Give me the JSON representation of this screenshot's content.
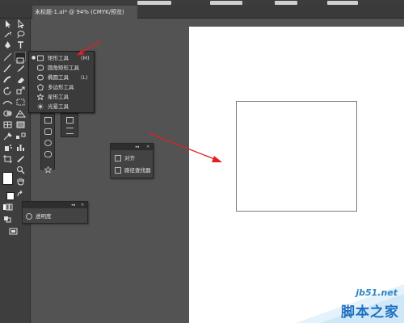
{
  "tab": {
    "title": "未标题-1.ai* @ 94% (CMYK/预览)"
  },
  "flyout": {
    "items": [
      {
        "label": "矩形工具",
        "shortcut": "(M)",
        "icon": "rectangle-icon",
        "selected": true
      },
      {
        "label": "圆角矩形工具",
        "shortcut": "",
        "icon": "rounded-rectangle-icon",
        "selected": false
      },
      {
        "label": "椭圆工具",
        "shortcut": "(L)",
        "icon": "ellipse-icon",
        "selected": false
      },
      {
        "label": "多边形工具",
        "shortcut": "",
        "icon": "polygon-icon",
        "selected": false
      },
      {
        "label": "星形工具",
        "shortcut": "",
        "icon": "star-icon",
        "selected": false
      },
      {
        "label": "光晕工具",
        "shortcut": "",
        "icon": "flare-icon",
        "selected": false
      }
    ]
  },
  "panels": {
    "align": {
      "items": [
        {
          "label": "对齐",
          "icon": "align-icon"
        },
        {
          "label": "路径查找器",
          "icon": "pathfinder-icon"
        }
      ]
    },
    "transparency": {
      "label": "透明度",
      "icon": "transparency-icon"
    }
  },
  "watermark": {
    "site": "jb51.net",
    "name": "脚本之家"
  },
  "colors": {
    "arrow": "#e02020",
    "app_bg": "#535353",
    "toolbox_bg": "#3e3e3e",
    "panel_bg": "#434343"
  }
}
